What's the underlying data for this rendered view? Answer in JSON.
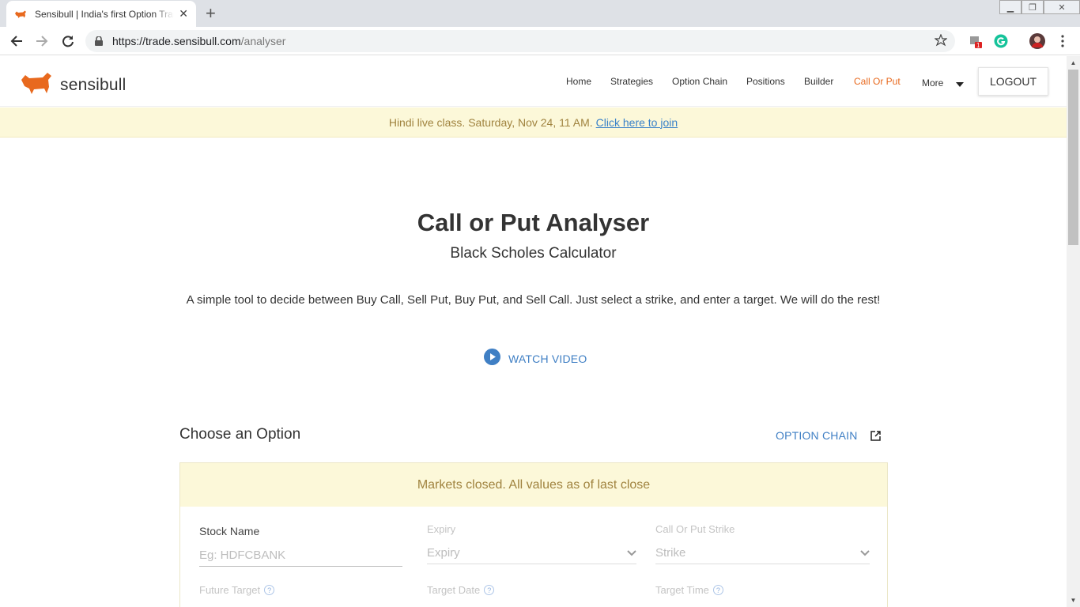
{
  "browser": {
    "tab_title": "Sensibull | India's first Option Trading Platform",
    "url_host": "https://trade.sensibull.com",
    "url_path": "/analyser",
    "extension_badge": "1"
  },
  "header": {
    "brand": "sensibull",
    "nav": [
      "Home",
      "Strategies",
      "Option Chain",
      "Positions",
      "Builder",
      "Call Or Put",
      "More"
    ],
    "active_nav": "Call Or Put",
    "logout_label": "LOGOUT"
  },
  "banner": {
    "text": "Hindi live class. Saturday, Nov 24, 11 AM.",
    "link": "Click here to join"
  },
  "main": {
    "title": "Call or Put Analyser",
    "subtitle": "Black Scholes Calculator",
    "description": "A simple tool to decide between Buy Call, Sell Put, Buy Put, and Sell Call. Just select a strike, and enter a target. We will do the rest!",
    "watch_video": "WATCH VIDEO",
    "section_title": "Choose an Option",
    "option_chain_link": "OPTION CHAIN"
  },
  "form": {
    "market_note": "Markets closed. All values as of last close",
    "stock_label": "Stock Name",
    "stock_placeholder": "Eg: HDFCBANK",
    "expiry_label": "Expiry",
    "expiry_value": "Expiry",
    "strike_label": "Call Or Put Strike",
    "strike_value": "Strike",
    "future_target_label": "Future Target",
    "target_date_label": "Target Date",
    "target_time_label": "Target Time",
    "help_glyph": "?"
  },
  "colors": {
    "accent": "#e8691e",
    "link": "#3f7fc4",
    "banner_bg": "#fcf8d9",
    "banner_text": "#a0833f"
  }
}
